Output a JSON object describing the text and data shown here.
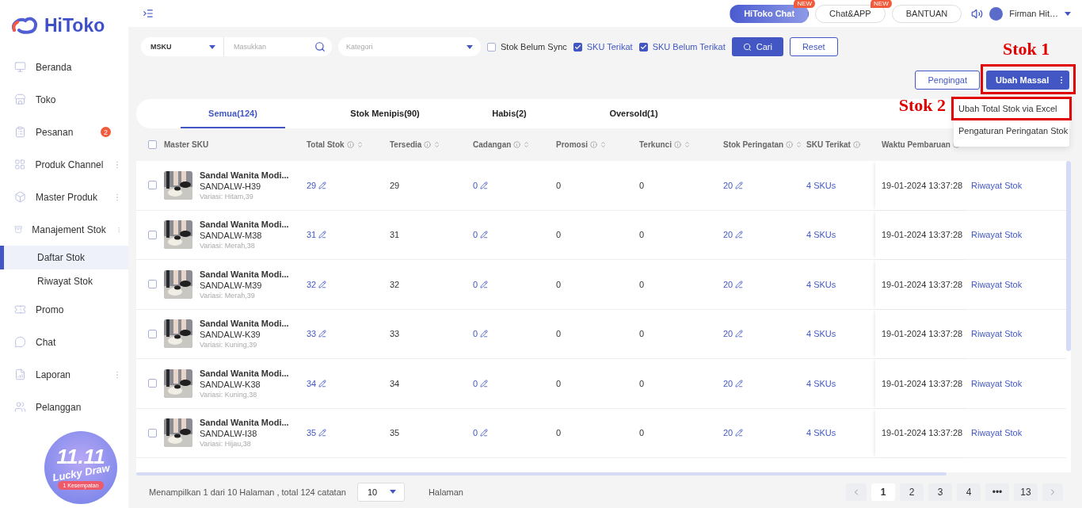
{
  "sidebar": {
    "logo": "HiToko",
    "items": [
      {
        "label": "Beranda",
        "more": false
      },
      {
        "label": "Toko",
        "more": false
      },
      {
        "label": "Pesanan",
        "badge": "2",
        "more": false
      },
      {
        "label": "Produk Channel",
        "more": true
      },
      {
        "label": "Master Produk",
        "more": true
      },
      {
        "label": "Manajement Stok",
        "more": true,
        "children": [
          {
            "label": "Daftar Stok",
            "selected": true
          },
          {
            "label": "Riwayat Stok",
            "selected": false
          }
        ]
      },
      {
        "label": "Promo",
        "more": false
      },
      {
        "label": "Chat",
        "more": false
      },
      {
        "label": "Laporan",
        "more": true
      },
      {
        "label": "Pelanggan",
        "more": false
      }
    ],
    "promo": {
      "title": "11.11",
      "subtitle": "Lucky Draw",
      "chances": "1 Kesempatan"
    }
  },
  "topbar": {
    "buttons": [
      {
        "label": "HiToko Chat",
        "primary": true,
        "badge": "NEW"
      },
      {
        "label": "Chat&APP",
        "primary": false,
        "badge": "NEW"
      },
      {
        "label": "BANTUAN",
        "primary": false
      }
    ],
    "user": "Firman Hit…"
  },
  "filters": {
    "field": "MSKU",
    "search_placeholder": "Masukkan",
    "category_placeholder": "Kategori",
    "checkboxes": [
      {
        "label": "Stok Belum Sync",
        "checked": false
      },
      {
        "label": "SKU Terikat",
        "checked": true
      },
      {
        "label": "SKU Belum Terikat",
        "checked": true
      }
    ],
    "search_button": "Cari",
    "reset_button": "Reset"
  },
  "actions": {
    "reminder_button": "Pengingat",
    "bulk_button": "Ubah Massal",
    "menu": [
      {
        "label": "Ubah Total Stok via Excel",
        "highlighted": true
      },
      {
        "label": "Pengaturan Peringatan Stok",
        "highlighted": false
      }
    ],
    "annotations": [
      "Stok 1",
      "Stok 2"
    ]
  },
  "tabs": [
    {
      "label": "Semua(124)",
      "selected": true
    },
    {
      "label": "Stok Menipis(90)",
      "selected": false
    },
    {
      "label": "Habis(2)",
      "selected": false
    },
    {
      "label": "Oversold(1)",
      "selected": false
    }
  ],
  "table": {
    "select_all": {
      "checked": false
    },
    "columns": [
      {
        "label": "Master SKU",
        "info": false,
        "sortable": false
      },
      {
        "label": "Total Stok",
        "info": true,
        "sortable": true
      },
      {
        "label": "Tersedia",
        "info": true,
        "sortable": true
      },
      {
        "label": "Cadangan",
        "info": true,
        "sortable": true
      },
      {
        "label": "Promosi",
        "info": true,
        "sortable": true
      },
      {
        "label": "Terkunci",
        "info": true,
        "sortable": true
      },
      {
        "label": "Stok Peringatan",
        "info": true,
        "sortable": true
      },
      {
        "label": "SKU Terikat",
        "info": true,
        "sortable": false
      },
      {
        "label": "Waktu Pembaruan",
        "info": true,
        "sortable": false
      }
    ],
    "rows": [
      {
        "checked": false,
        "name": "Sandal Wanita Modi...",
        "sku": "SANDALW-H39",
        "variant": "Variasi: Hitam,39",
        "total": "29",
        "available": "29",
        "reserved": "0",
        "promo": "0",
        "locked": "0",
        "alert": "20",
        "linked": "4 SKUs",
        "updated": "19-01-2024 13:37:28",
        "action": "Riwayat Stok"
      },
      {
        "checked": false,
        "name": "Sandal Wanita Modi...",
        "sku": "SANDALW-M38",
        "variant": "Variasi: Merah,38",
        "total": "31",
        "available": "31",
        "reserved": "0",
        "promo": "0",
        "locked": "0",
        "alert": "20",
        "linked": "4 SKUs",
        "updated": "19-01-2024 13:37:28",
        "action": "Riwayat Stok"
      },
      {
        "checked": false,
        "name": "Sandal Wanita Modi...",
        "sku": "SANDALW-M39",
        "variant": "Variasi: Merah,39",
        "total": "32",
        "available": "32",
        "reserved": "0",
        "promo": "0",
        "locked": "0",
        "alert": "20",
        "linked": "4 SKUs",
        "updated": "19-01-2024 13:37:28",
        "action": "Riwayat Stok"
      },
      {
        "checked": false,
        "name": "Sandal Wanita Modi...",
        "sku": "SANDALW-K39",
        "variant": "Variasi: Kuning,39",
        "total": "33",
        "available": "33",
        "reserved": "0",
        "promo": "0",
        "locked": "0",
        "alert": "20",
        "linked": "4 SKUs",
        "updated": "19-01-2024 13:37:28",
        "action": "Riwayat Stok"
      },
      {
        "checked": false,
        "name": "Sandal Wanita Modi...",
        "sku": "SANDALW-K38",
        "variant": "Variasi: Kuning,38",
        "total": "34",
        "available": "34",
        "reserved": "0",
        "promo": "0",
        "locked": "0",
        "alert": "20",
        "linked": "4 SKUs",
        "updated": "19-01-2024 13:37:28",
        "action": "Riwayat Stok"
      },
      {
        "checked": false,
        "name": "Sandal Wanita Modi...",
        "sku": "SANDALW-I38",
        "variant": "Variasi: Hijau,38",
        "total": "35",
        "available": "35",
        "reserved": "0",
        "promo": "0",
        "locked": "0",
        "alert": "20",
        "linked": "4 SKUs",
        "updated": "19-01-2024 13:37:28",
        "action": "Riwayat Stok"
      }
    ]
  },
  "footer": {
    "summary": "Menampilkan 1 dari 10 Halaman , total 124 catatan",
    "page_size": "10",
    "page_label": "Halaman",
    "pages": [
      {
        "label": "1",
        "selected": true
      },
      {
        "label": "2",
        "selected": false
      },
      {
        "label": "3",
        "selected": false
      },
      {
        "label": "4",
        "selected": false
      },
      {
        "label": "•••",
        "selected": false
      },
      {
        "label": "13",
        "selected": false
      }
    ]
  }
}
